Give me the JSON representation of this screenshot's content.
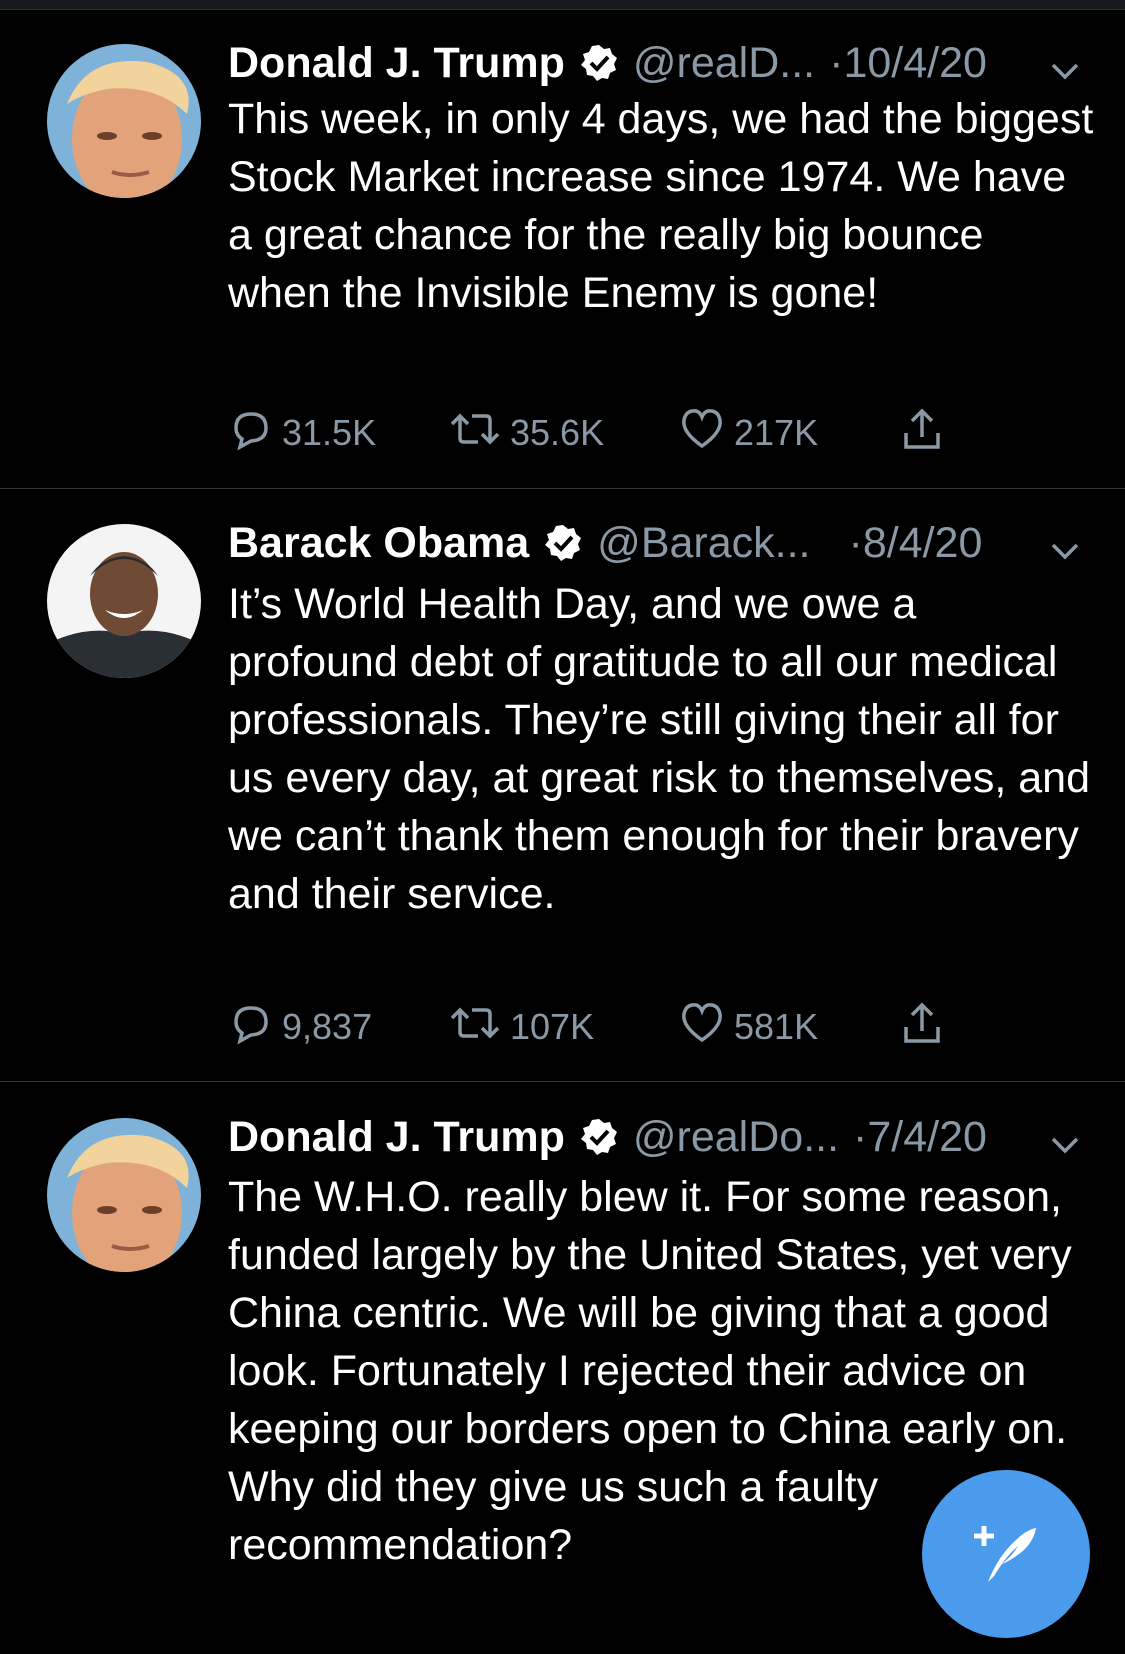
{
  "colors": {
    "background": "#000000",
    "text": "#ffffff",
    "muted": "#8b98a5",
    "divider": "#2f3336",
    "accent": "#4a9bec"
  },
  "tweets": [
    {
      "name": "Donald J. Trump",
      "handle": "@realD...",
      "date": "10/4/20",
      "dot": "·",
      "text": "This week, in only 4 days, we had the biggest Stock Market increase since 1974. We have a great chance for the really big bounce when the Invisible Enemy is gone!",
      "replies": "31.5K",
      "retweets": "35.6K",
      "likes": "217K"
    },
    {
      "name": "Barack Obama",
      "handle": "@Barack...",
      "date": "8/4/20",
      "dot": "·",
      "text": "It’s World Health Day, and we owe a profound debt of gratitude to all our medical professionals. They’re still giving their all for us every day, at great risk to themselves, and we can’t thank them enough for their bravery and their service.",
      "replies": "9,837",
      "retweets": "107K",
      "likes": "581K"
    },
    {
      "name": "Donald J. Trump",
      "handle": "@realDo...",
      "date": "7/4/20",
      "dot": "·",
      "text": "The W.H.O. really blew it. For some reason, funded largely by the United States, yet very China centric. We will be giving that a good look. Fortunately I rejected their advice on keeping our borders open to China early on. Why did they give us such a faulty recommendation?"
    }
  ],
  "icons": {
    "verified": "verified-badge-icon",
    "reply": "reply-icon",
    "retweet": "retweet-icon",
    "like": "heart-icon",
    "share": "share-icon",
    "menu": "chevron-down-icon",
    "compose": "compose-tweet-icon"
  }
}
